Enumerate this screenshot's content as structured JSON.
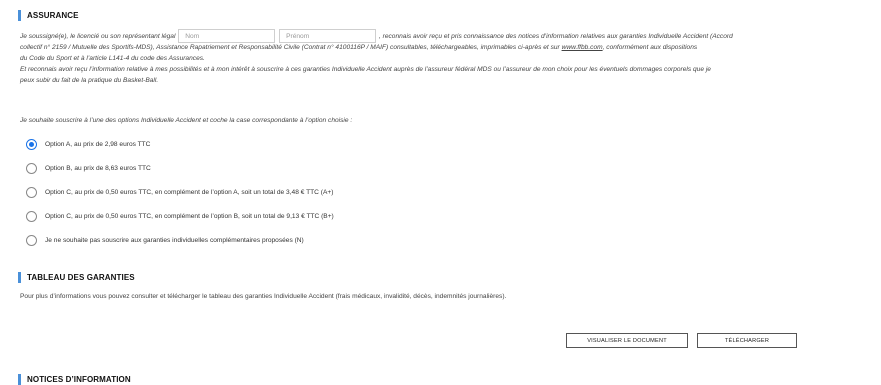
{
  "assurance": {
    "title": "ASSURANCE",
    "line1_before": "Je soussigné(e), le licencié ou son représentant légal",
    "nom_placeholder": "Nom",
    "prenom_placeholder": "Prénom",
    "line1_after": ", reconnais avoir reçu et pris connaissance des notices d’information relatives aux garanties Individuelle Accident (Accord",
    "line2_before": "collectif n° 2159 / Mutuelle des Sportifs-MDS), Assistance Rapatriement et Responsabilité Civile (Contrat n° 4100116P / MAIF) consultables, téléchargeables, imprimables ci-après et sur ",
    "line2_link": "www.ffbb.com",
    "line2_after": ", conformément aux dispositions",
    "line3": "du Code du Sport et à l’article L141-4 du code des Assurances.",
    "line4": "Et reconnais avoir reçu l’information relative à mes possibilités et à mon intérêt à souscrire à ces garanties Individuelle Accident auprès de l’assureur fédéral MDS ou l’assureur de mon choix pour les éventuels dommages corporels que je",
    "line5": "peux subir du fait de la pratique du Basket-Ball.",
    "choose_text": "Je souhaite souscrire à l’une des options Individuelle Accident et coche la case correspondante à l’option choisie :",
    "options": [
      {
        "label": "Option A, au prix de 2,98 euros TTC",
        "checked": true
      },
      {
        "label": "Option B, au prix de 8,63 euros TTC",
        "checked": false
      },
      {
        "label": "Option C, au prix de 0,50 euros TTC, en complément de l’option A, soit un total de 3,48 € TTC (A+)",
        "checked": false
      },
      {
        "label": "Option C, au prix de 0,50 euros TTC, en complément de l’option B, soit un total de 9,13 € TTC (B+)",
        "checked": false
      },
      {
        "label": "Je ne souhaite pas souscrire aux garanties individuelles complémentaires proposées (N)",
        "checked": false
      }
    ]
  },
  "tableau": {
    "title": "TABLEAU DES GARANTIES",
    "text": "Pour plus d’informations vous pouvez consulter et télécharger le tableau des garanties Individuelle Accident (frais médicaux, invalidité, décès, indemnités journalières).",
    "view_button": "VISUALISER LE DOCUMENT",
    "download_button": "TÉLÉCHARGER"
  },
  "notices": {
    "title": "NOTICES D’INFORMATION"
  },
  "colors": {
    "accent": "#4a90d9",
    "radio_checked": "#1a73e8"
  }
}
